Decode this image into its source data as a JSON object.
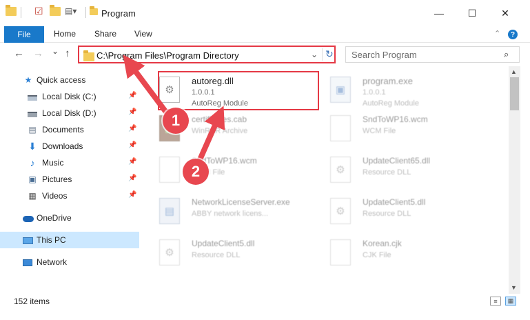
{
  "window": {
    "title": "Program",
    "controls": {
      "minimize": "—",
      "maximize": "☐",
      "close": "✕"
    }
  },
  "ribbon": {
    "file_tab": "File",
    "tabs": [
      "Home",
      "Share",
      "View"
    ],
    "help": "?",
    "collapse": "⌃"
  },
  "nav": {
    "back": "←",
    "forward": "→",
    "dropdown": "⌄",
    "up": "↑",
    "address": "C:\\Program Files\\Program Directory",
    "address_chevron": "⌄",
    "refresh": "↻",
    "search_placeholder": "Search Program",
    "search_icon": "⌕"
  },
  "sidebar": {
    "items": [
      {
        "label": "Quick access",
        "icon": "star-icon"
      },
      {
        "label": "Local Disk (C:)",
        "icon": "drive-icon",
        "pinned": true
      },
      {
        "label": "Local Disk (D:)",
        "icon": "drive-icon",
        "pinned": true
      },
      {
        "label": "Documents",
        "icon": "documents-icon",
        "pinned": true
      },
      {
        "label": "Downloads",
        "icon": "downloads-icon",
        "pinned": true
      },
      {
        "label": "Music",
        "icon": "music-icon",
        "pinned": true
      },
      {
        "label": "Pictures",
        "icon": "pictures-icon",
        "pinned": true
      },
      {
        "label": "Videos",
        "icon": "videos-icon",
        "pinned": true
      },
      {
        "label": "OneDrive",
        "icon": "onedrive-icon"
      },
      {
        "label": "This PC",
        "icon": "pc-icon",
        "active": true
      },
      {
        "label": "Network",
        "icon": "network-icon"
      }
    ]
  },
  "files": [
    {
      "name": "autoreg.dll",
      "line2": "1.0.0.1",
      "line3": "AutoReg Module",
      "icon": "dll-icon",
      "highlighted": true
    },
    {
      "name": "program.exe",
      "line2": "1.0.0.1",
      "line3": "AutoReg Module",
      "icon": "exe-icon"
    },
    {
      "name": "certificates.cab",
      "line2": "WinRAR Archive",
      "line3": "",
      "icon": "cab-icon"
    },
    {
      "name": "SndToWP16.wcm",
      "line2": "WCM File",
      "line3": "",
      "icon": "file-icon"
    },
    {
      "name": "SndToWP16.wcm",
      "line2": "WCM File",
      "line3": "",
      "icon": "file-icon"
    },
    {
      "name": "UpdateClient65.dll",
      "line2": "Resource DLL",
      "line3": "",
      "icon": "dll-icon"
    },
    {
      "name": "NetworkLicenseServer.exe",
      "line2": "ABBY network licens...",
      "line3": "",
      "icon": "net-exe-icon"
    },
    {
      "name": "UpdateClient5.dll",
      "line2": "Resource DLL",
      "line3": "",
      "icon": "dll-icon"
    },
    {
      "name": "UpdateClient5.dll",
      "line2": "Resource DLL",
      "line3": "",
      "icon": "dll-icon"
    },
    {
      "name": "Korean.cjk",
      "line2": "CJK File",
      "line3": "",
      "icon": "file-icon"
    }
  ],
  "annotations": {
    "marker1": "1",
    "marker2": "2"
  },
  "status": {
    "items_count": "152 items"
  },
  "colors": {
    "accent": "#1979ca",
    "highlight": "#e53945",
    "marker": "#e8474f",
    "selected": "#cce8ff"
  }
}
